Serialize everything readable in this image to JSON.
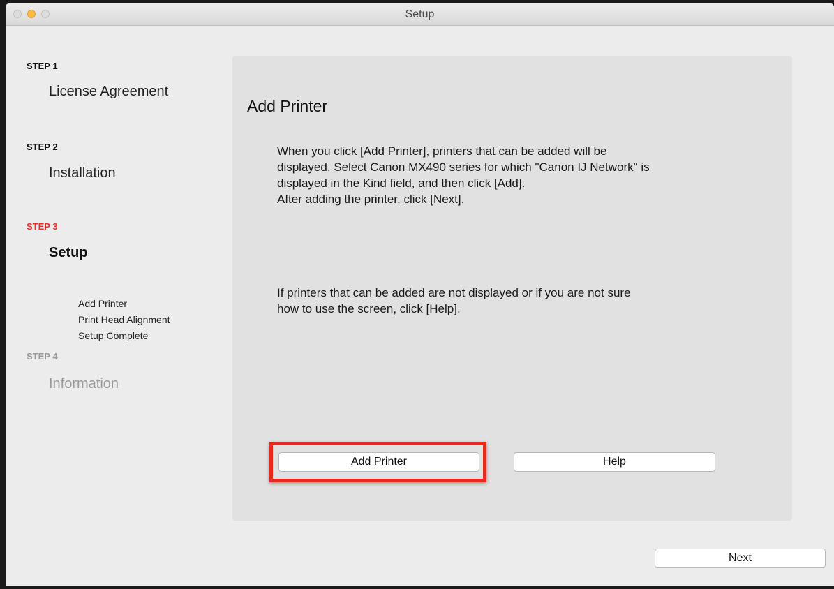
{
  "window": {
    "title": "Setup"
  },
  "sidebar": {
    "steps": [
      {
        "heading": "STEP 1",
        "title": "License Agreement"
      },
      {
        "heading": "STEP 2",
        "title": "Installation"
      },
      {
        "heading": "STEP 3",
        "title": "Setup",
        "substeps": [
          "Add Printer",
          "Print Head Alignment",
          "Setup Complete"
        ]
      },
      {
        "heading": "STEP 4",
        "title": "Information"
      }
    ],
    "active_step_color": "#e53030"
  },
  "main": {
    "title": "Add Printer",
    "paragraph1_lines": [
      "When you click [Add Printer], printers that can be added will be",
      "displayed. Select Canon MX490 series for which \"Canon IJ Network\" is",
      "displayed in the Kind field, and then click [Add].",
      "After adding the printer, click [Next]."
    ],
    "paragraph2_lines": [
      "If printers that can be added are not displayed or if you are not sure",
      "how to use the screen, click [Help]."
    ],
    "add_printer_label": "Add Printer",
    "help_label": "Help",
    "highlight_color": "#e8291f"
  },
  "footer": {
    "next_label": "Next"
  }
}
